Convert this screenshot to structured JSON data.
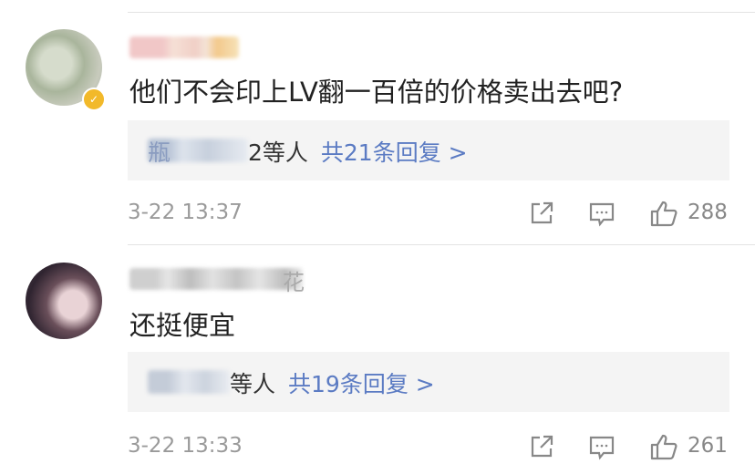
{
  "comments": [
    {
      "username_visible": "",
      "text": "他们不会印上LV翻一百倍的价格卖出去吧?",
      "replies": {
        "names_visible": "瓶",
        "names_suffix": "2等人",
        "count_link": "共21条回复 >"
      },
      "timestamp": "3-22 13:37",
      "likes": "288",
      "verified": true
    },
    {
      "username_visible": "花",
      "text": "还挺便宜",
      "replies": {
        "names_visible": "",
        "names_suffix": "等人",
        "count_link": "共19条回复 >"
      },
      "timestamp": "3-22 13:33",
      "likes": "261",
      "verified": false
    }
  ],
  "colors": {
    "link": "#5b7bc3",
    "reply_bg": "#f4f4f4",
    "meta_text": "#9a9a9a",
    "verified_badge": "#f2b92a"
  },
  "icons": [
    "share-icon",
    "comment-icon",
    "like-icon",
    "verified-icon"
  ]
}
